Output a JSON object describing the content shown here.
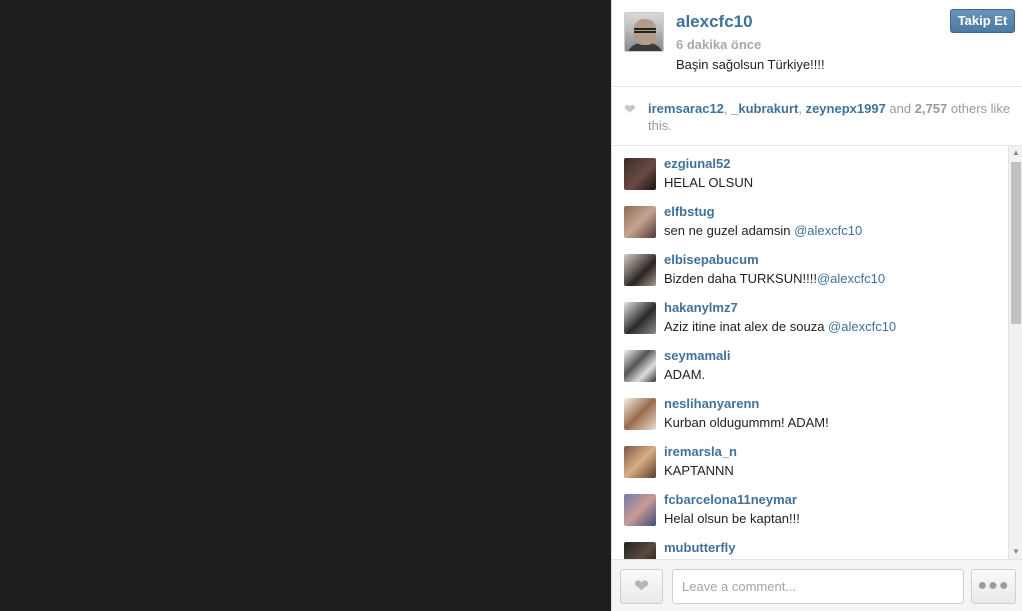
{
  "post": {
    "username": "alexcfc10",
    "time": "6 dakika önce",
    "caption": "Başin sağolsun Türkiye!!!! ",
    "follow_label": "Takip Et",
    "avatar_icon": "user-photo-avatar"
  },
  "likes": {
    "icon": "heart-icon",
    "users": [
      "iremsarac12",
      "_kubrakurt",
      "zeynepx1997"
    ],
    "sep1": ", ",
    "sep2": ", ",
    "and_word": " and ",
    "count": "2,757",
    "suffix": " others like this."
  },
  "comments": [
    {
      "user": "ezgiunal52",
      "text": "HELAL OLSUN ",
      "mention": ""
    },
    {
      "user": "elfbstug",
      "text": "sen ne guzel adamsin ",
      "mention": "@alexcfc10"
    },
    {
      "user": "elbisepabucum",
      "text": "Bizden daha TURKSUN!!!!",
      "mention": "@alexcfc10"
    },
    {
      "user": "hakanylmz7",
      "text": "Aziz itine inat alex de souza ",
      "mention": "@alexcfc10"
    },
    {
      "user": "seymamali",
      "text": "ADAM.",
      "mention": ""
    },
    {
      "user": "neslihanyarenn",
      "text": "Kurban oldugummm! ADAM!",
      "mention": ""
    },
    {
      "user": "iremarsla_n",
      "text": "KAPTANNN",
      "mention": ""
    },
    {
      "user": "fcbarcelona11neymar",
      "text": "Helal olsun be kaptan!!!",
      "mention": ""
    },
    {
      "user": "mubutterfly",
      "text": "",
      "mention": ""
    }
  ],
  "footer": {
    "like_icon": "heart-icon",
    "comment_placeholder": "Leave a comment...",
    "more_icon": "ellipsis-icon"
  },
  "scrollbar": {
    "up_icon": "arrow-up-icon",
    "down_icon": "arrow-down-icon"
  },
  "colors": {
    "link": "#3f729b",
    "follow_button": "#4b7aa4",
    "media_background": "#1c1d1f"
  }
}
